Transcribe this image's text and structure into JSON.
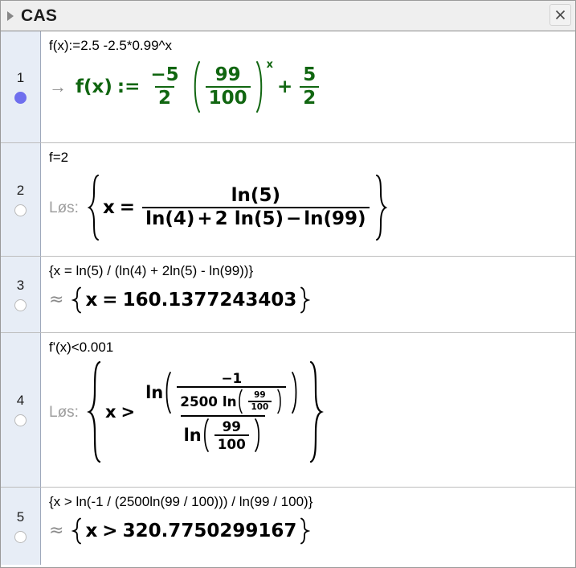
{
  "window": {
    "title": "CAS",
    "disclosure_icon": "triangle-right-icon",
    "close_icon": "close-icon"
  },
  "colors": {
    "definition_green": "#116611",
    "marker_column": "#e7edf6",
    "active_dot": "#6f6fee",
    "header_bg": "#efefef",
    "prefix_gray": "#9a9a9a"
  },
  "rows": [
    {
      "number": "1",
      "marker_state": "filled",
      "input": "f(x):=2.5 -2.5*0.99^x",
      "output_prefix": "→",
      "output_prefix_kind": "arrow",
      "output_plain": "f(x) := (-5/2) (99/100)^x + 5/2",
      "output_color": "green",
      "parts": {
        "fx": "f(x)",
        "assign": ":=",
        "frac1_num": "−5",
        "frac1_den": "2",
        "frac2_num": "99",
        "frac2_den": "100",
        "exponent": "x",
        "plus": "+",
        "frac3_num": "5",
        "frac3_den": "2"
      }
    },
    {
      "number": "2",
      "marker_state": "hollow",
      "input": "f=2",
      "output_prefix": "Løs:",
      "output_prefix_kind": "word",
      "output_plain": "{x = ln(5) / (ln(4) + 2 ln(5) − ln(99))}",
      "output_color": "black",
      "parts": {
        "var": "x",
        "rel": "=",
        "num": "ln(5)",
        "den_a": "ln(4)",
        "den_plus": "+",
        "den_two": "2",
        "den_b": "ln(5)",
        "den_minus": "−",
        "den_c": "ln(99)"
      }
    },
    {
      "number": "3",
      "marker_state": "hollow",
      "input": "{x = ln(5) / (ln(4) + 2ln(5) - ln(99))}",
      "output_prefix": "≈",
      "output_prefix_kind": "approx",
      "output_plain": "{x = 160.1377243403}",
      "output_color": "black",
      "parts": {
        "var": "x",
        "rel": "=",
        "value": "160.1377243403"
      }
    },
    {
      "number": "4",
      "marker_state": "hollow",
      "input": "f'(x)<0.001",
      "output_prefix": "Løs:",
      "output_prefix_kind": "word",
      "output_plain": "{x > ln(-1 / (2500 ln(99/100))) / ln(99/100)}",
      "output_color": "black",
      "parts": {
        "var": "x",
        "rel": ">",
        "ln_outer": "ln",
        "inner_num": "−1",
        "inner_den_coeff": "2500",
        "inner_den_ln": "ln",
        "inner_den_frac_num": "99",
        "inner_den_frac_den": "100",
        "lower_ln": "ln",
        "lower_num": "99",
        "lower_den": "100"
      }
    },
    {
      "number": "5",
      "marker_state": "hollow",
      "input": "{x > ln(-1 / (2500ln(99 / 100))) / ln(99 / 100)}",
      "output_prefix": "≈",
      "output_prefix_kind": "approx",
      "output_plain": "{x > 320.7750299167}",
      "output_color": "black",
      "parts": {
        "var": "x",
        "rel": ">",
        "value": "320.7750299167"
      }
    }
  ]
}
